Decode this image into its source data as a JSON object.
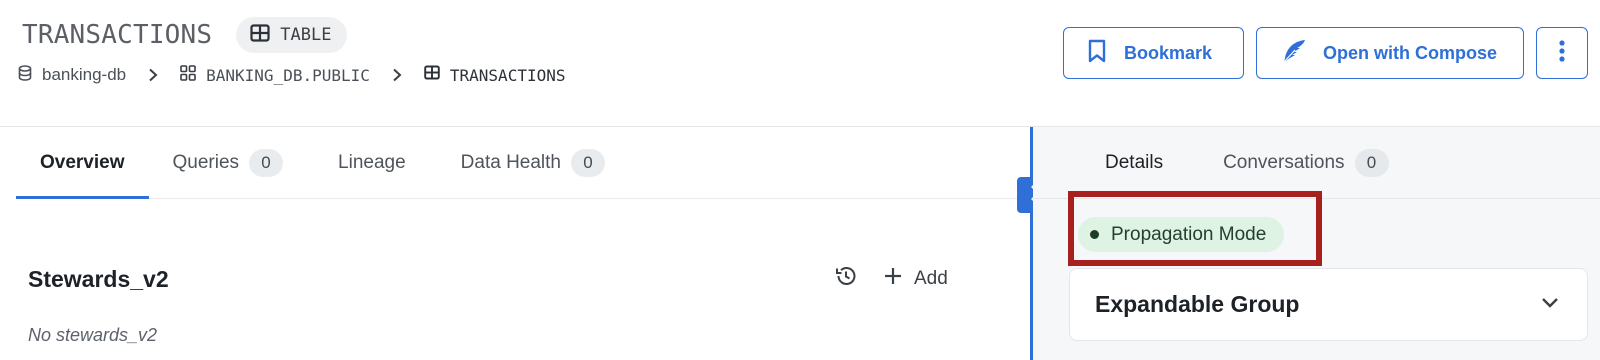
{
  "header": {
    "title": "TRANSACTIONS",
    "type_badge": {
      "label": "TABLE",
      "icon": "table-icon"
    },
    "breadcrumb": [
      {
        "label": "banking-db",
        "icon": "database-icon"
      },
      {
        "label": "BANKING_DB.PUBLIC",
        "icon": "schema-grid-icon"
      },
      {
        "label": "TRANSACTIONS",
        "icon": "table-icon"
      }
    ],
    "actions": {
      "bookmark_label": "Bookmark",
      "compose_label": "Open with Compose",
      "more_icon": "kebab-menu-icon"
    }
  },
  "main": {
    "tabs": [
      {
        "label": "Overview",
        "active": true
      },
      {
        "label": "Queries",
        "count": "0"
      },
      {
        "label": "Lineage"
      },
      {
        "label": "Data Health",
        "count": "0"
      }
    ],
    "section": {
      "title": "Stewards_v2",
      "add_label": "Add",
      "empty_text": "No stewards_v2"
    }
  },
  "sidebar": {
    "tabs": [
      {
        "label": "Details",
        "active": true
      },
      {
        "label": "Conversations",
        "count": "0"
      }
    ],
    "propagation_badge": "Propagation Mode",
    "expandable_group_title": "Expandable Group"
  },
  "colors": {
    "accent": "#2e6fd8",
    "highlight": "#a8201e",
    "badge_bg": "#dff3e4"
  }
}
